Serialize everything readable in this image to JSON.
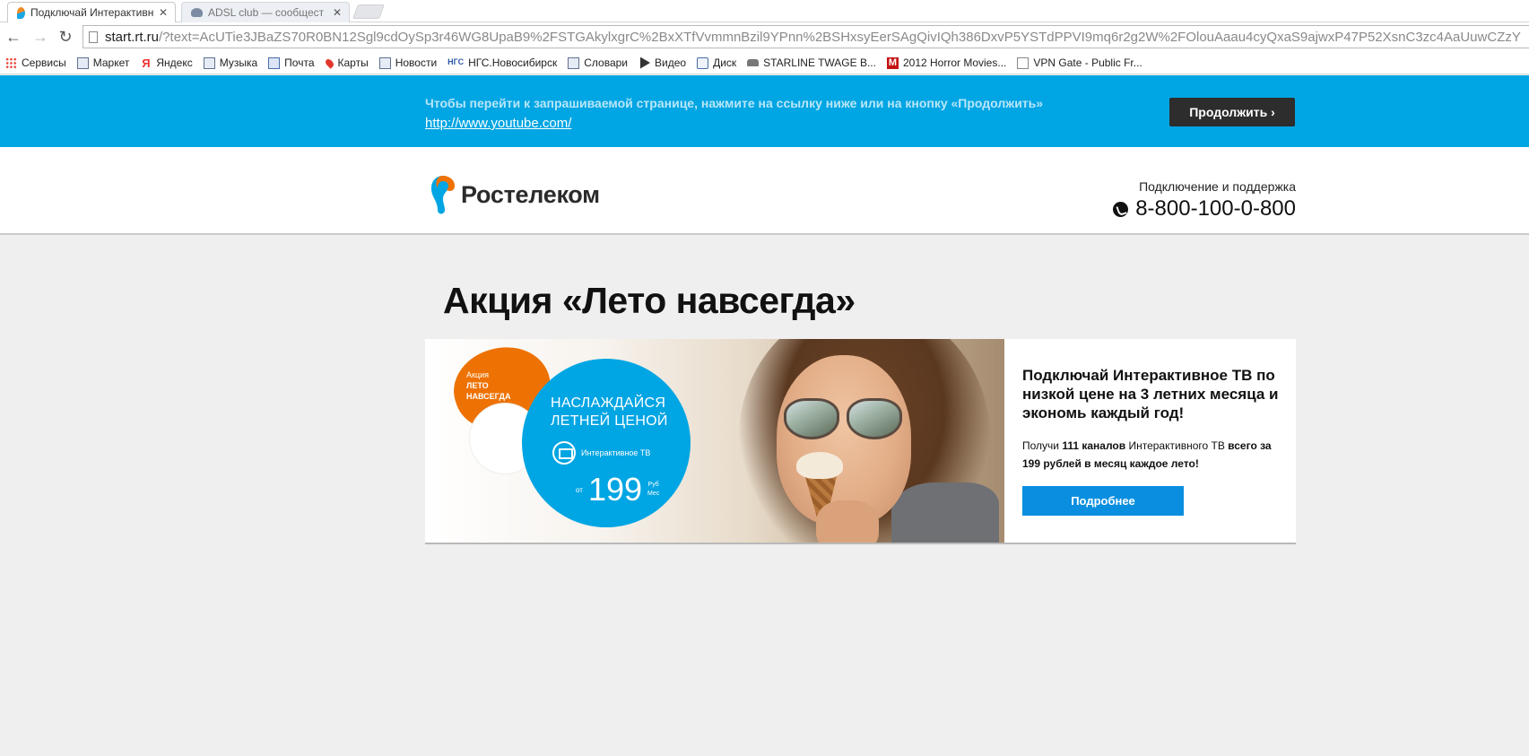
{
  "browser": {
    "tabs": [
      {
        "title": "Подключай Интерактивн",
        "active": true,
        "icon": "rostelecom-favicon"
      },
      {
        "title": "ADSL club — сообщест",
        "active": false,
        "icon": "adsl-favicon"
      }
    ],
    "close_glyph": "✕",
    "url_host": "start.rt.ru",
    "url_path": "/?text=AcUTie3JBaZS70R0BN12Sgl9cdOySp3r46WG8UpaB9%2FSTGAkylxgrC%2BxXTfVvmmnBzil9YPnn%2BSHxsyEerSAgQivIQh386DxvP5YSTdPPVI9mq6r2g2W%2FOlouAaau4cyQxaS9ajwxP47P52XsnC3zc4AaUuwCZzY",
    "bookmarks": [
      {
        "label": "Сервисы",
        "icon": "apps-icon"
      },
      {
        "label": "Маркет",
        "icon": "market-icon"
      },
      {
        "label": "Яндекс",
        "icon": "yandex-icon"
      },
      {
        "label": "Музыка",
        "icon": "music-icon"
      },
      {
        "label": "Почта",
        "icon": "mail-icon"
      },
      {
        "label": "Карты",
        "icon": "maps-pin-icon"
      },
      {
        "label": "Новости",
        "icon": "news-icon"
      },
      {
        "label": "НГС.Новосибирск",
        "icon": "ngs-icon"
      },
      {
        "label": "Словари",
        "icon": "dictionary-icon"
      },
      {
        "label": "Видео",
        "icon": "video-icon"
      },
      {
        "label": "Диск",
        "icon": "disk-icon"
      },
      {
        "label": "STARLINE TWAGE B...",
        "icon": "car-icon"
      },
      {
        "label": "2012 Horror Movies...",
        "icon": "m-icon"
      },
      {
        "label": "VPN Gate - Public Fr...",
        "icon": "page-icon"
      }
    ]
  },
  "redirect": {
    "message": "Чтобы перейти к запрашиваемой странице, нажмите на ссылку ниже или на кнопку «Продолжить»",
    "link": "http://www.youtube.com/",
    "continue_label": "Продолжить ›"
  },
  "header": {
    "logo_text": "Ростелеком",
    "support_label": "Подключение и поддержка",
    "phone": "8-800-100-0-800"
  },
  "promo": {
    "title": "Акция «Лето навсегда»",
    "badge_small": "Акция",
    "badge_line1": "ЛЕТО",
    "badge_line2": "НАВСЕГДА",
    "headline_line1": "НАСЛАЖДАЙСЯ",
    "headline_line2": "ЛЕТНЕЙ ЦЕНОЙ",
    "tv_label": "Интерактивное ТВ",
    "price_from": "от",
    "price_value": "199",
    "price_currency": "Руб",
    "price_period": "Мес",
    "heading": "Подключай Интерактивное ТВ по низкой цене на 3 летних месяца и экономь каждый год!",
    "desc_pre": "Получи ",
    "desc_bold1": "111 каналов",
    "desc_mid": " Интерактивного ТВ ",
    "desc_bold2": "всего за 199 рублей в месяц каждое лето!",
    "more_label": "Подробнее"
  },
  "colors": {
    "brand_blue": "#00a5e3",
    "brand_orange": "#ee7203",
    "button_dark": "#2d2d2d",
    "button_blue": "#0a8fe0"
  }
}
